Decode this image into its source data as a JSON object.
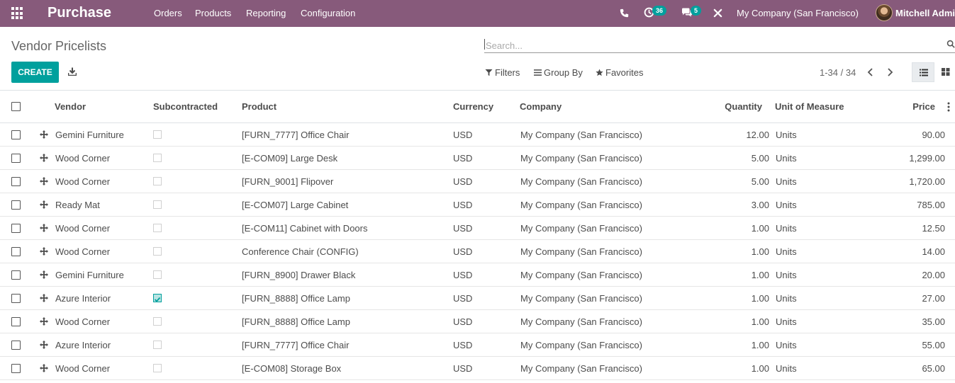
{
  "app": {
    "name": "Purchase",
    "menus": [
      "Orders",
      "Products",
      "Reporting",
      "Configuration"
    ],
    "activity_count": "36",
    "message_count": "5",
    "company": "My Company (San Francisco)",
    "user": "Mitchell Admin"
  },
  "control_panel": {
    "title": "Vendor Pricelists",
    "search_placeholder": "Search...",
    "create_label": "CREATE",
    "filters_label": "Filters",
    "group_by_label": "Group By",
    "favorites_label": "Favorites",
    "pager": "1-34 / 34"
  },
  "table": {
    "headers": {
      "vendor": "Vendor",
      "subcontracted": "Subcontracted",
      "product": "Product",
      "currency": "Currency",
      "company": "Company",
      "quantity": "Quantity",
      "uom": "Unit of Measure",
      "price": "Price"
    },
    "rows": [
      {
        "vendor": "Gemini Furniture",
        "subcontracted": false,
        "product": "[FURN_7777] Office Chair",
        "currency": "USD",
        "company": "My Company (San Francisco)",
        "quantity": "12.00",
        "uom": "Units",
        "price": "90.00"
      },
      {
        "vendor": "Wood Corner",
        "subcontracted": false,
        "product": "[E-COM09] Large Desk",
        "currency": "USD",
        "company": "My Company (San Francisco)",
        "quantity": "5.00",
        "uom": "Units",
        "price": "1,299.00"
      },
      {
        "vendor": "Wood Corner",
        "subcontracted": false,
        "product": "[FURN_9001] Flipover",
        "currency": "USD",
        "company": "My Company (San Francisco)",
        "quantity": "5.00",
        "uom": "Units",
        "price": "1,720.00"
      },
      {
        "vendor": "Ready Mat",
        "subcontracted": false,
        "product": "[E-COM07] Large Cabinet",
        "currency": "USD",
        "company": "My Company (San Francisco)",
        "quantity": "3.00",
        "uom": "Units",
        "price": "785.00"
      },
      {
        "vendor": "Wood Corner",
        "subcontracted": false,
        "product": "[E-COM11] Cabinet with Doors",
        "currency": "USD",
        "company": "My Company (San Francisco)",
        "quantity": "1.00",
        "uom": "Units",
        "price": "12.50"
      },
      {
        "vendor": "Wood Corner",
        "subcontracted": false,
        "product": "Conference Chair (CONFIG)",
        "currency": "USD",
        "company": "My Company (San Francisco)",
        "quantity": "1.00",
        "uom": "Units",
        "price": "14.00"
      },
      {
        "vendor": "Gemini Furniture",
        "subcontracted": false,
        "product": "[FURN_8900] Drawer Black",
        "currency": "USD",
        "company": "My Company (San Francisco)",
        "quantity": "1.00",
        "uom": "Units",
        "price": "20.00"
      },
      {
        "vendor": "Azure Interior",
        "subcontracted": true,
        "product": "[FURN_8888] Office Lamp",
        "currency": "USD",
        "company": "My Company (San Francisco)",
        "quantity": "1.00",
        "uom": "Units",
        "price": "27.00"
      },
      {
        "vendor": "Wood Corner",
        "subcontracted": false,
        "product": "[FURN_8888] Office Lamp",
        "currency": "USD",
        "company": "My Company (San Francisco)",
        "quantity": "1.00",
        "uom": "Units",
        "price": "35.00"
      },
      {
        "vendor": "Azure Interior",
        "subcontracted": false,
        "product": "[FURN_7777] Office Chair",
        "currency": "USD",
        "company": "My Company (San Francisco)",
        "quantity": "1.00",
        "uom": "Units",
        "price": "55.00"
      },
      {
        "vendor": "Wood Corner",
        "subcontracted": false,
        "product": "[E-COM08] Storage Box",
        "currency": "USD",
        "company": "My Company (San Francisco)",
        "quantity": "1.00",
        "uom": "Units",
        "price": "65.00"
      }
    ]
  },
  "colors": {
    "navbar": "#875a7b",
    "accent": "#00a09d"
  },
  "icons": [
    "apps-grid-icon",
    "phone-icon",
    "activity-clock-icon",
    "chat-icon",
    "close-x-icon",
    "search-icon",
    "download-icon",
    "filter-icon",
    "group-by-icon",
    "star-icon",
    "chevron-left-icon",
    "chevron-right-icon",
    "list-view-icon",
    "kanban-view-icon",
    "drag-handle-icon",
    "column-options-icon"
  ]
}
